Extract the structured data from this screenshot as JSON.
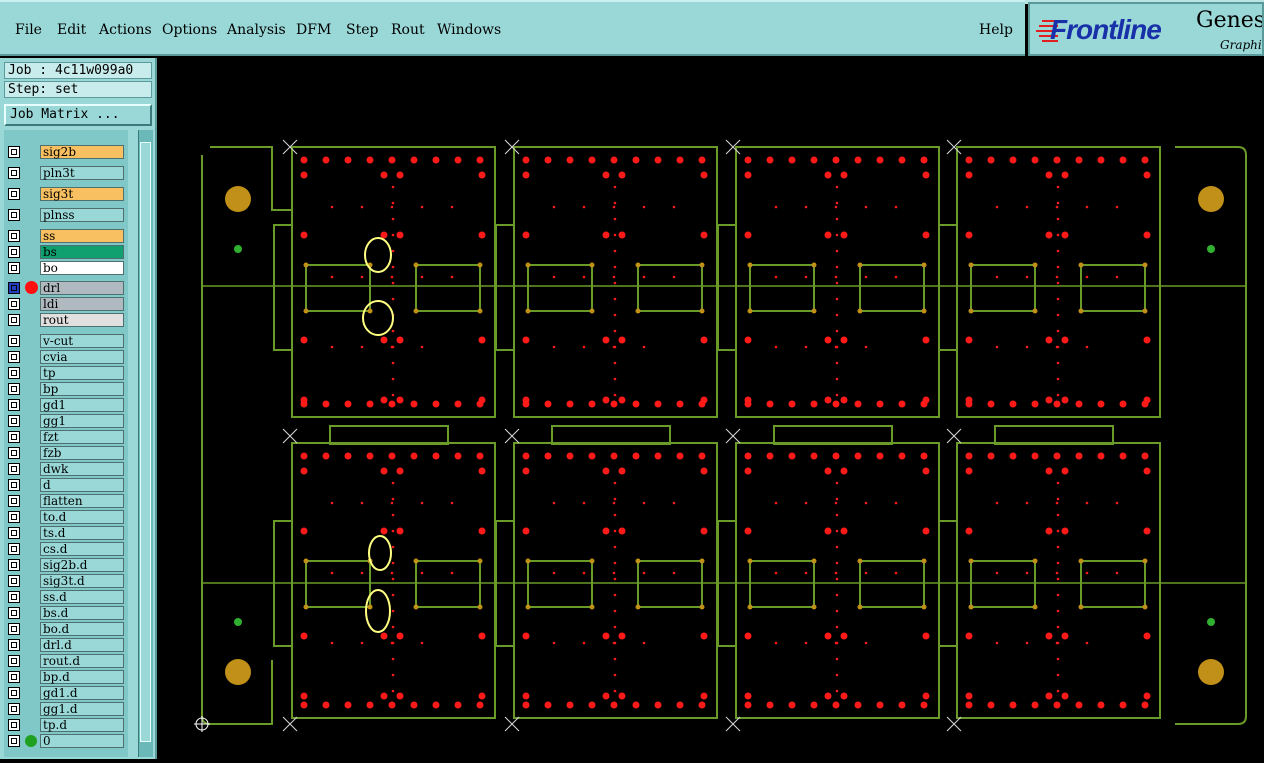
{
  "menubar": {
    "items": [
      {
        "label": "File"
      },
      {
        "label": "Edit"
      },
      {
        "label": "Actions"
      },
      {
        "label": "Options"
      },
      {
        "label": "Analysis"
      },
      {
        "label": "DFM"
      },
      {
        "label": "Step"
      },
      {
        "label": "Rout"
      },
      {
        "label": "Windows"
      }
    ],
    "help": "Help"
  },
  "logo": {
    "brand": "Frontline",
    "product": "Genesis",
    "sub": "Graphic"
  },
  "sidebar": {
    "job": "Job : 4c11w099a0",
    "step": "Step: set",
    "job_matrix": "Job Matrix ...",
    "layers": [
      {
        "name": "sig2b",
        "color": "#f8c060"
      },
      {
        "name": "pln3t",
        "color": "#9ad8d8"
      },
      {
        "name": "sig3t",
        "color": "#f8c060"
      },
      {
        "name": "plnss",
        "color": "#9ad8d8"
      },
      {
        "name": "ss",
        "color": "#f8c060"
      },
      {
        "name": "bs",
        "color": "#10a070"
      },
      {
        "name": "bo",
        "color": "#ffffff"
      },
      {
        "name": "drl",
        "color": "#b0b8c0"
      },
      {
        "name": "ldi",
        "color": "#b0b8c0"
      },
      {
        "name": "rout",
        "color": "#e0e0e0"
      },
      {
        "name": "v-cut",
        "color": "#9ad8d8"
      },
      {
        "name": "cvia",
        "color": "#9ad8d8"
      },
      {
        "name": "tp",
        "color": "#9ad8d8"
      },
      {
        "name": "bp",
        "color": "#9ad8d8"
      },
      {
        "name": "gd1",
        "color": "#9ad8d8"
      },
      {
        "name": "gg1",
        "color": "#9ad8d8"
      },
      {
        "name": "fzt",
        "color": "#9ad8d8"
      },
      {
        "name": "fzb",
        "color": "#9ad8d8"
      },
      {
        "name": "dwk",
        "color": "#9ad8d8"
      },
      {
        "name": "d",
        "color": "#9ad8d8"
      },
      {
        "name": "flatten",
        "color": "#9ad8d8"
      },
      {
        "name": "to.d",
        "color": "#9ad8d8"
      },
      {
        "name": "ts.d",
        "color": "#9ad8d8"
      },
      {
        "name": "cs.d",
        "color": "#9ad8d8"
      },
      {
        "name": "sig2b.d",
        "color": "#9ad8d8"
      },
      {
        "name": "sig3t.d",
        "color": "#9ad8d8"
      },
      {
        "name": "ss.d",
        "color": "#9ad8d8"
      },
      {
        "name": "bs.d",
        "color": "#9ad8d8"
      },
      {
        "name": "bo.d",
        "color": "#9ad8d8"
      },
      {
        "name": "drl.d",
        "color": "#9ad8d8"
      },
      {
        "name": "rout.d",
        "color": "#9ad8d8"
      },
      {
        "name": "bp.d",
        "color": "#9ad8d8"
      },
      {
        "name": "gd1.d",
        "color": "#9ad8d8"
      },
      {
        "name": "gg1.d",
        "color": "#9ad8d8"
      },
      {
        "name": "tp.d",
        "color": "#9ad8d8"
      },
      {
        "name": "0",
        "color": "#9ad8d8"
      }
    ]
  },
  "colors": {
    "outline": "#6a9a28",
    "pad": "#ff1a1a",
    "fiducial": "#c09018",
    "highlight": "#ffff80",
    "menu_bg": "#9ad8d8"
  }
}
